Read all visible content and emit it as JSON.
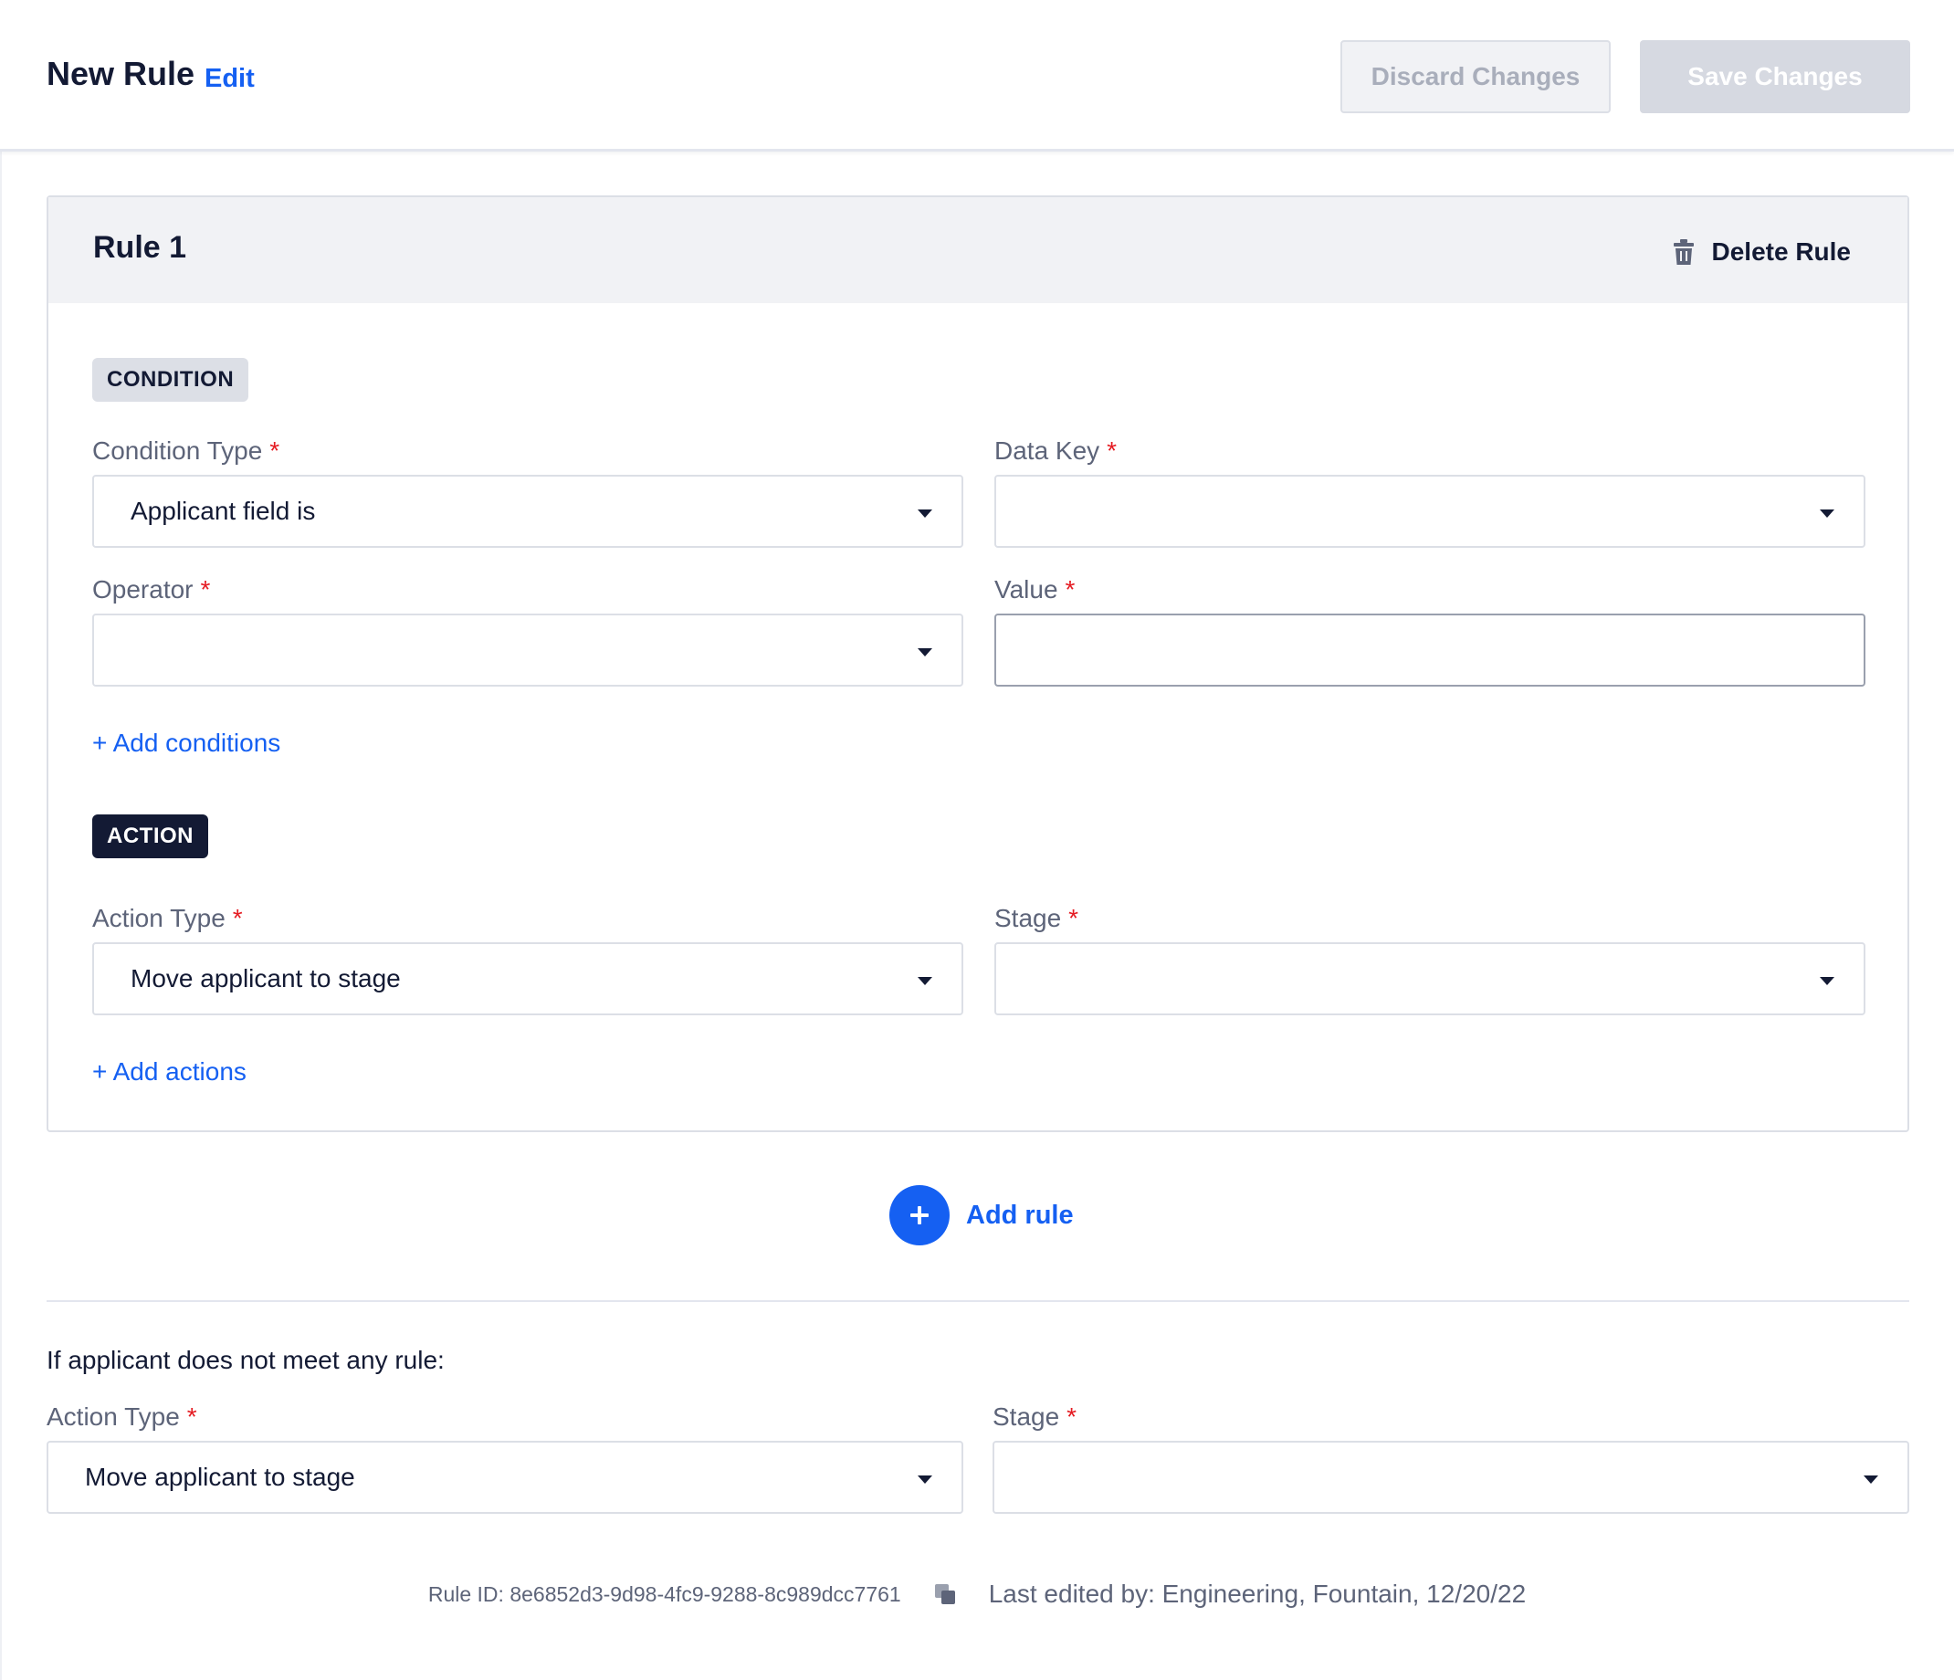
{
  "header": {
    "title": "New Rule",
    "edit_link": "Edit",
    "discard_button": "Discard Changes",
    "save_button": "Save Changes"
  },
  "rule": {
    "title": "Rule 1",
    "delete_label": "Delete Rule",
    "condition_badge": "CONDITION",
    "condition_type_label": "Condition Type",
    "condition_type_value": "Applicant field is",
    "data_key_label": "Data Key",
    "data_key_value": "",
    "operator_label": "Operator",
    "operator_value": "",
    "value_label": "Value",
    "value_value": "",
    "add_conditions": "+ Add conditions",
    "action_badge": "ACTION",
    "action_type_label": "Action Type",
    "action_type_value": "Move applicant to stage",
    "stage_label": "Stage",
    "stage_value": "",
    "add_actions": "+ Add actions",
    "required_mark": "*"
  },
  "add_rule": {
    "label": "Add rule",
    "icon": "plus-icon"
  },
  "fallback": {
    "text": "If applicant does not meet any rule:",
    "action_type_label": "Action Type",
    "action_type_value": "Move applicant to stage",
    "stage_label": "Stage",
    "stage_value": ""
  },
  "footer": {
    "rule_id": "Rule ID: 8e6852d3-9d98-4fc9-9288-8c989dcc7761",
    "last_edited": "Last edited by: Engineering, Fountain, 12/20/22"
  },
  "colors": {
    "accent": "#1560f2",
    "dark": "#131a34",
    "muted": "#5d6479",
    "required": "#e51c23",
    "panel": "#f1f2f5",
    "border": "#dcdfe6"
  }
}
